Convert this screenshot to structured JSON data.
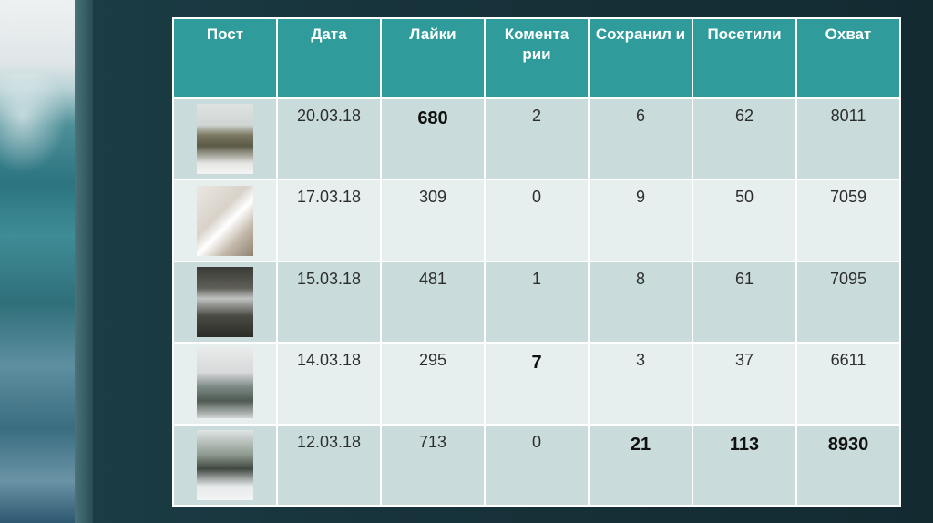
{
  "table": {
    "headers": [
      "Пост",
      "Дата",
      "Лайки",
      "Комента рии",
      "Сохранил и",
      "Посетили",
      "Охват"
    ],
    "rows": [
      {
        "thumb": "forest-photo",
        "date": "20.03.18",
        "likes": "680",
        "comments": "2",
        "saved": "6",
        "visited": "62",
        "reach": "8011"
      },
      {
        "thumb": "spa-people-photo",
        "date": "17.03.18",
        "likes": "309",
        "comments": "0",
        "saved": "9",
        "visited": "50",
        "reach": "7059"
      },
      {
        "thumb": "glass-door-photo",
        "date": "15.03.18",
        "likes": "481",
        "comments": "1",
        "saved": "8",
        "visited": "61",
        "reach": "7095"
      },
      {
        "thumb": "building-person-photo",
        "date": "14.03.18",
        "likes": "295",
        "comments": "7",
        "saved": "3",
        "visited": "37",
        "reach": "6611"
      },
      {
        "thumb": "winter-building-photo",
        "date": "12.03.18",
        "likes": "713",
        "comments": "0",
        "saved": "21",
        "visited": "113",
        "reach": "8930"
      }
    ]
  },
  "colors": {
    "header": "#2f9c9b",
    "row_odd": "#c9dcdb",
    "row_even": "#e6eeee",
    "background": "#17333b"
  }
}
